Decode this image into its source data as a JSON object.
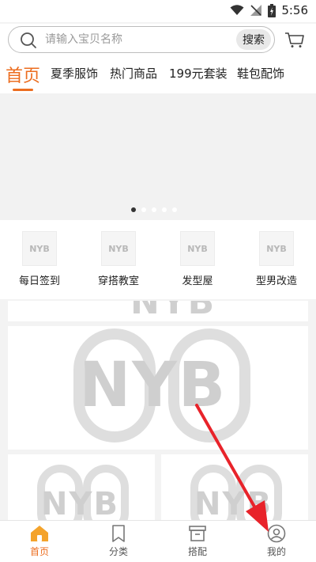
{
  "status_bar": {
    "time": "5:56"
  },
  "search": {
    "placeholder": "请输入宝贝名称",
    "button_label": "搜索"
  },
  "tabs": [
    {
      "label": "首页",
      "active": true
    },
    {
      "label": "夏季服饰"
    },
    {
      "label": "热门商品"
    },
    {
      "label": "199元套装"
    },
    {
      "label": "鞋包配饰"
    }
  ],
  "quick_links": [
    {
      "label": "每日签到",
      "logo_text": "NYB"
    },
    {
      "label": "穿搭教室",
      "logo_text": "NYB"
    },
    {
      "label": "发型屋",
      "logo_text": "NYB"
    },
    {
      "label": "型男改造",
      "logo_text": "NYB"
    }
  ],
  "watermark_text": "NYB",
  "bottom_nav": [
    {
      "label": "首页",
      "icon": "home-icon",
      "active": true
    },
    {
      "label": "分类",
      "icon": "bookmark-icon"
    },
    {
      "label": "搭配",
      "icon": "box-icon"
    },
    {
      "label": "我的",
      "icon": "user-icon"
    }
  ],
  "colors": {
    "accent": "#ec6d1f",
    "arrow": "#e8232a"
  }
}
